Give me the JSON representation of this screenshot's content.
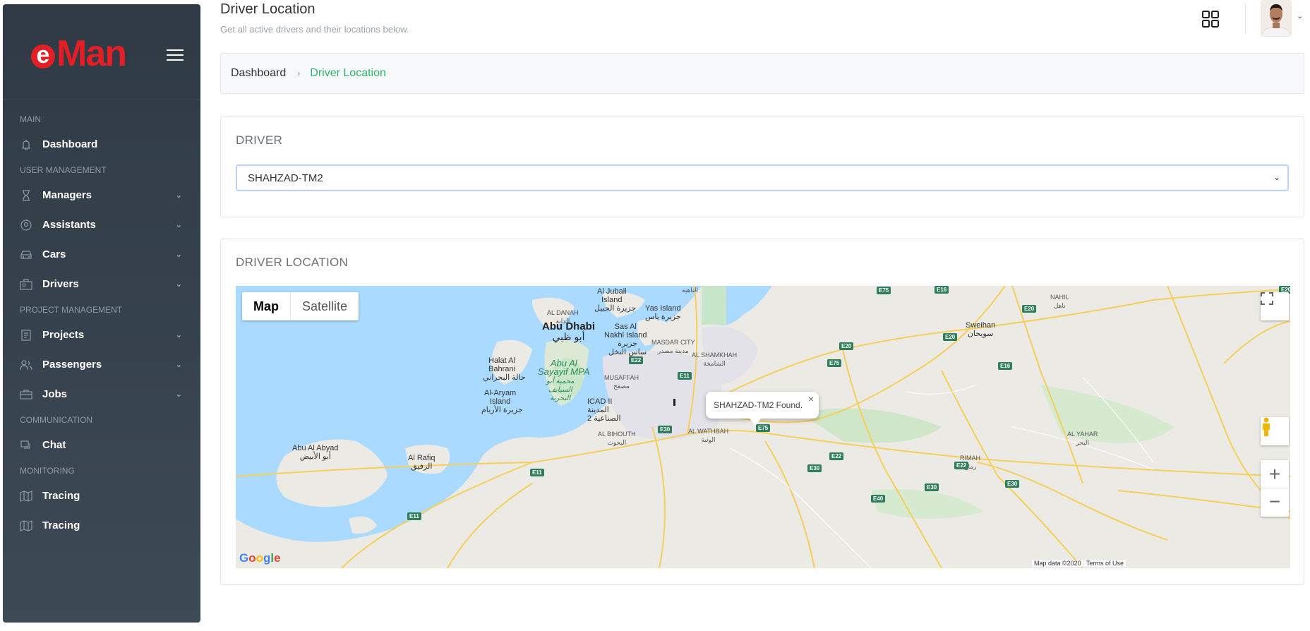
{
  "sidebar": {
    "brand": "eMan",
    "sections": [
      {
        "label": "MAIN",
        "items": [
          {
            "label": "Dashboard",
            "icon": "bell-icon",
            "has_children": false
          }
        ]
      },
      {
        "label": "USER MANAGEMENT",
        "items": [
          {
            "label": "Managers",
            "icon": "hourglass-icon",
            "has_children": true
          },
          {
            "label": "Assistants",
            "icon": "user-circle-icon",
            "has_children": true
          },
          {
            "label": "Cars",
            "icon": "car-icon",
            "has_children": true
          },
          {
            "label": "Drivers",
            "icon": "driver-icon",
            "has_children": true
          }
        ]
      },
      {
        "label": "PROJECT MANAGEMENT",
        "items": [
          {
            "label": "Projects",
            "icon": "clipboard-icon",
            "has_children": true
          },
          {
            "label": "Passengers",
            "icon": "users-icon",
            "has_children": true
          },
          {
            "label": "Jobs",
            "icon": "briefcase-icon",
            "has_children": true
          }
        ]
      },
      {
        "label": "COMMUNICATION",
        "items": [
          {
            "label": "Chat",
            "icon": "chat-icon",
            "has_children": false
          }
        ]
      },
      {
        "label": "MONITORING",
        "items": [
          {
            "label": "Tracing",
            "icon": "map-icon",
            "has_children": false
          },
          {
            "label": "Tracing",
            "icon": "map-icon",
            "has_children": false
          }
        ]
      }
    ]
  },
  "header": {
    "title": "Driver Location",
    "subtitle": "Get all active drivers and their locations below."
  },
  "breadcrumb": {
    "home": "Dashboard",
    "separator": "›",
    "current": "Driver Location"
  },
  "driver_card": {
    "title": "DRIVER",
    "selected_driver": "SHAHZAD-TM2"
  },
  "location_card": {
    "title": "DRIVER LOCATION"
  },
  "map": {
    "type_buttons": [
      "Map",
      "Satellite"
    ],
    "active_type": "Map",
    "info_window": "SHAHZAD-TM2 Found.",
    "info_close": "×",
    "zoom_in": "+",
    "zoom_out": "−",
    "google_logo": "Google",
    "map_data": "Map data ©2020",
    "terms": "Terms of Use",
    "labels": {
      "abu_dhabi": "Abu Dhabi",
      "abu_dhabi_ar": "أبو ظبي",
      "al_jubail": "Al Jubail\nIsland",
      "al_jubail_ar": "جزيرة الجبيل",
      "yas_island": "Yas Island",
      "yas_island_ar": "جزيرة ياس",
      "sas_al_nakhl": "Sas Al\nNakhl Island",
      "sas_al_nakhl_ar": "جزيرة\nساس النخل",
      "al_danah": "AL DANAH",
      "al_danah_ar": "الدانة",
      "masdar_city": "MASDAR CITY",
      "masdar_city_ar": "مدينة مصدر",
      "al_shamkhah": "AL SHAMKHAH",
      "al_shamkhah_ar": "الشامخة",
      "halat_al_bahrani": "Halat Al\nBahrani",
      "halat_al_bahrani_ar": "حالة البحراني",
      "abu_al_sayayif": "Abu Al\nSayayif MPA",
      "abu_al_sayayif_ar": "محمية أبو\nالسيايف\nالبحرية",
      "musaffah": "MUSAFFAH",
      "musaffah_ar": "مصفح",
      "al_aryam": "Al-Aryam\nIsland",
      "al_aryam_ar": "جزيرة الأريام",
      "icad": "ICAD II\nالمدينة\n2 الصناعية",
      "al_bihouth": "AL BIHOUTH",
      "al_bihouth_ar": "البحوث",
      "al_wathbah": "AL WATHBAH",
      "al_wathbah_ar": "الوثبة",
      "abu_al_abyad": "Abu Al Abyad",
      "abu_al_abyad_ar": "أبو الأبيض",
      "al_rafiq": "Al Rafiq",
      "al_rafiq_ar": "الرفيق",
      "nahil": "NAHIL",
      "nahil_ar": "ناهل",
      "sweihan": "Sweihan",
      "sweihan_ar": "سويحان",
      "al_yahar": "AL YAHAR",
      "al_yahar_ar": "اليحر",
      "rimah": "RIMAH",
      "rimah_ar": "رماح",
      "al_nahiyah_ar": "الناهية"
    },
    "road_shields": [
      "E75",
      "E16",
      "E20",
      "E20",
      "E20",
      "E20",
      "E75",
      "E16",
      "E22",
      "E11",
      "E30",
      "E75",
      "E22",
      "E30",
      "E22",
      "E30",
      "E30",
      "E40",
      "E11",
      "E11"
    ]
  },
  "colors": {
    "sidebar_top": "#2f3a45",
    "sidebar_bottom": "#3d4954",
    "accent_green": "#2db36b",
    "brand_red": "#e31e24",
    "water": "#aadaff",
    "land": "#ebeae5"
  }
}
